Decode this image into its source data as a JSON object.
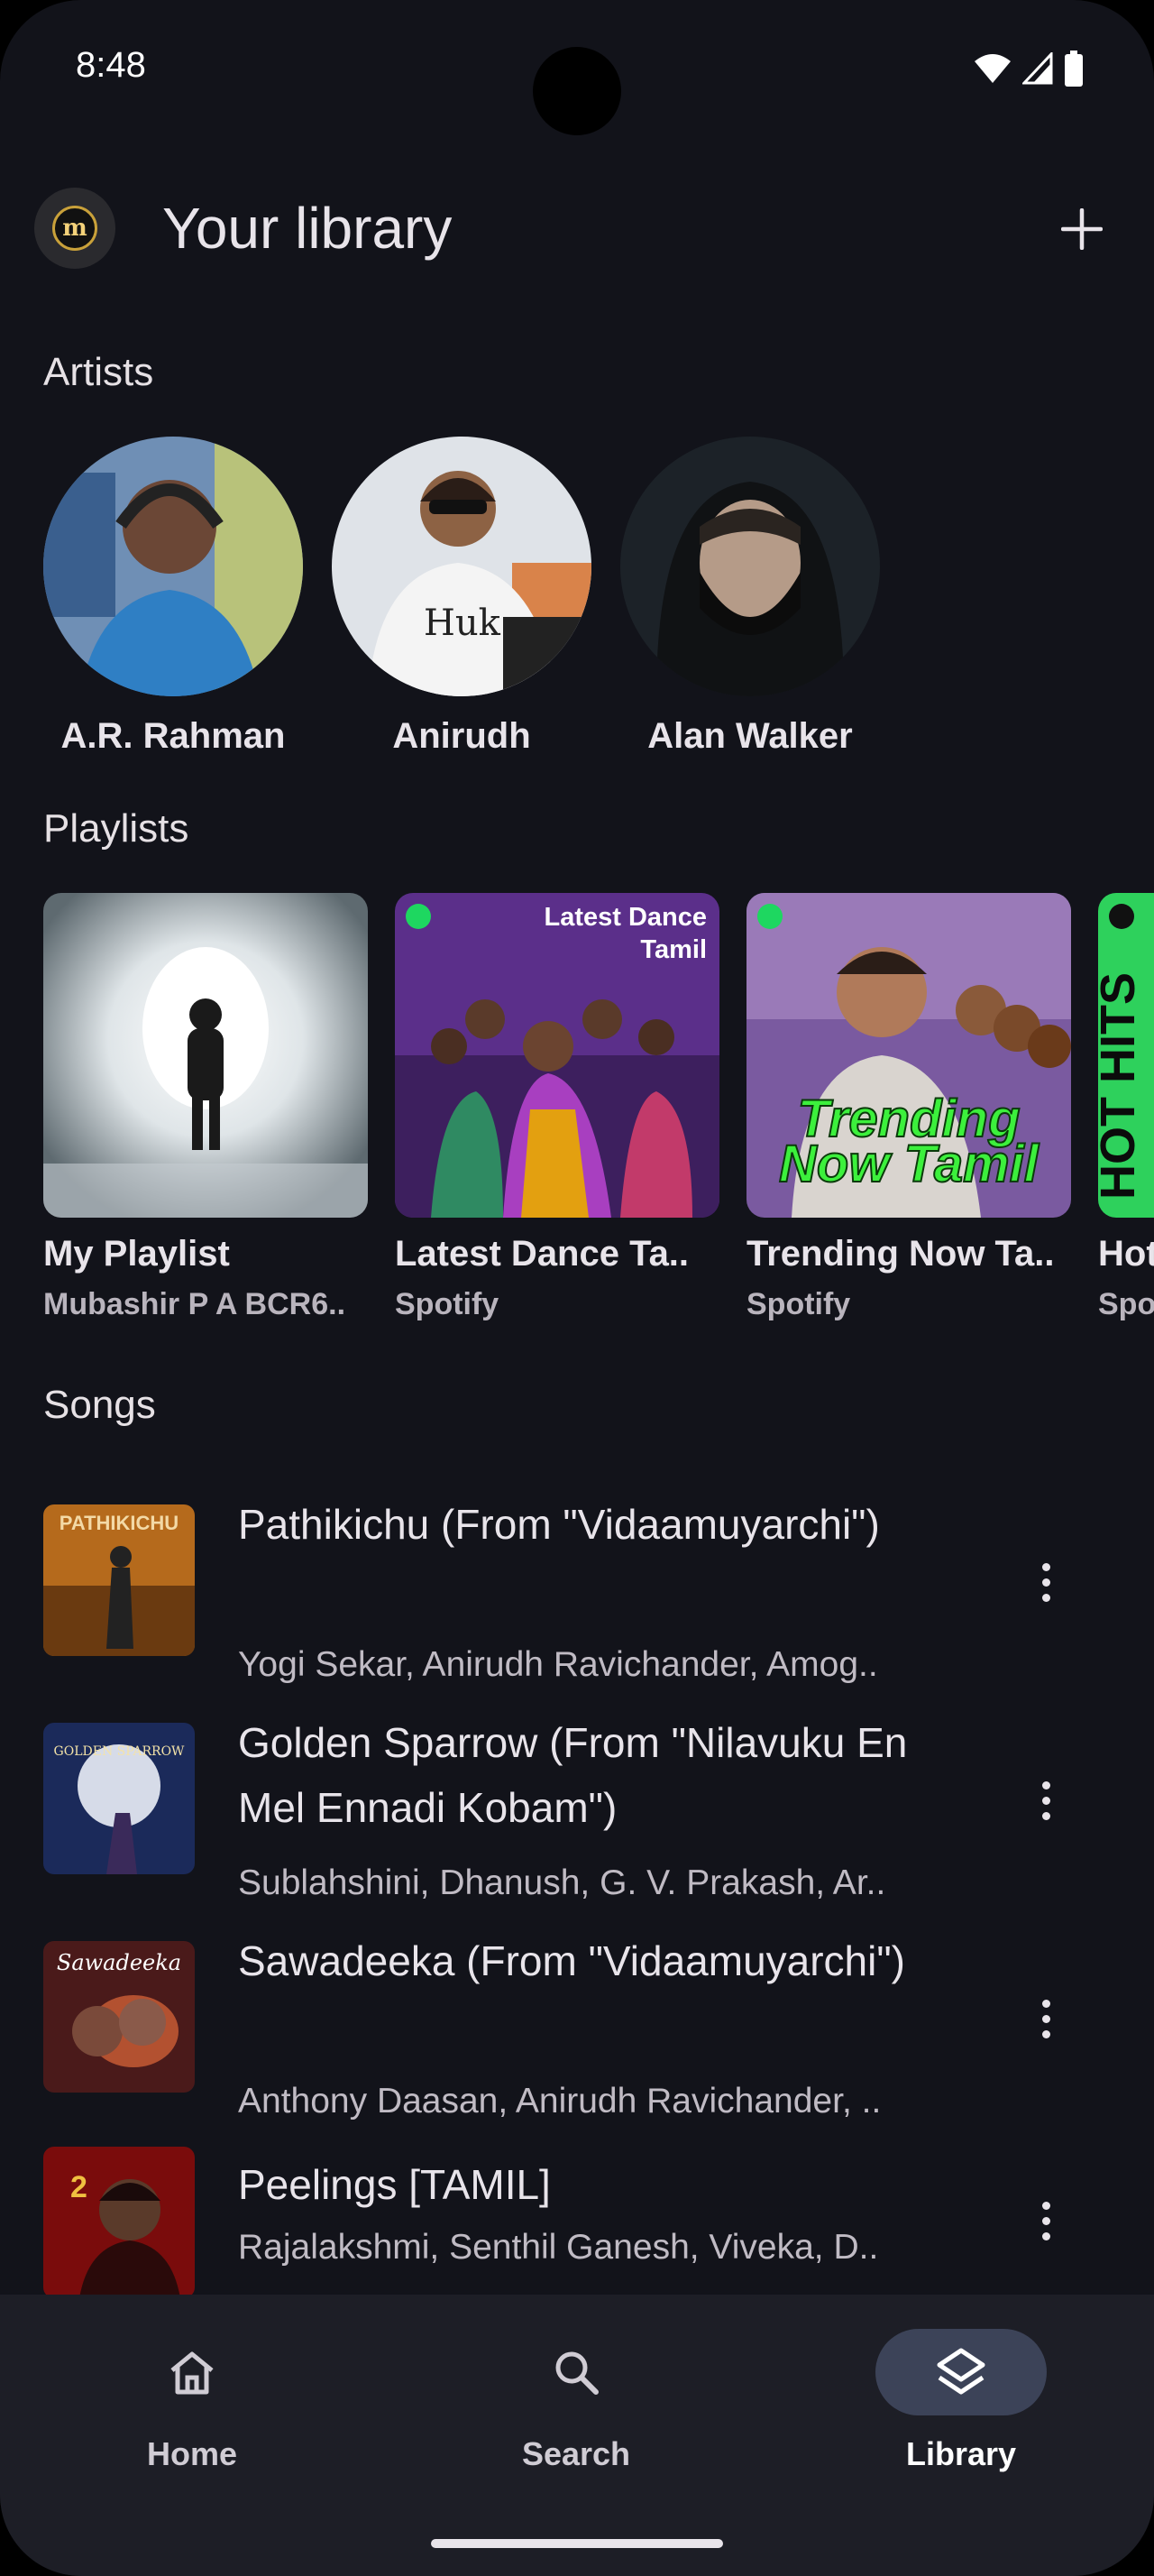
{
  "status": {
    "time": "8:48"
  },
  "header": {
    "title": "Your library",
    "logo_letter": "m"
  },
  "sections": {
    "artists": "Artists",
    "playlists": "Playlists",
    "songs": "Songs"
  },
  "artists": [
    {
      "name": "A.R. Rahman"
    },
    {
      "name": "Anirudh"
    },
    {
      "name": "Alan Walker"
    }
  ],
  "playlists": [
    {
      "name": "My Playlist",
      "owner": "Mubashir P A BCR6.."
    },
    {
      "name": "Latest Dance Ta..",
      "owner": "Spotify",
      "cover_text": "Latest Dance Tamil தமிழ்"
    },
    {
      "name": "Trending Now Ta..",
      "owner": "Spotify",
      "cover_text": "Trending Now Tamil"
    },
    {
      "name": "Hot",
      "owner": "Spo",
      "cover_text": "HOT HITS"
    }
  ],
  "songs": [
    {
      "title": "Pathikichu (From \"Vidaamuyarchi\")",
      "artists": "Yogi Sekar, Anirudh Ravichander, Amog..",
      "cover_text": "PATHIKICHU"
    },
    {
      "title": "Golden Sparrow (From \"Nilavuku En Mel Ennadi Kobam\")",
      "artists": "Sublahshini, Dhanush, G. V. Prakash, Ar..",
      "cover_text": "GOLDEN SPARROW"
    },
    {
      "title": "Sawadeeka (From \"Vidaamuyarchi\")",
      "artists": "Anthony Daasan, Anirudh Ravichander, ..",
      "cover_text": "Sawadeeka"
    },
    {
      "title": "Peelings [TAMIL]",
      "artists": "Rajalakshmi, Senthil Ganesh, Viveka, D..",
      "cover_text": ""
    }
  ],
  "nav": [
    {
      "label": "Home",
      "icon": "home-icon"
    },
    {
      "label": "Search",
      "icon": "search-icon"
    },
    {
      "label": "Library",
      "icon": "layers-icon",
      "active": true
    }
  ],
  "colors": {
    "background": "#12131a",
    "navbar": "#1d1e26",
    "active_pill": "#3c4358",
    "spotify_green": "#1ed760"
  }
}
